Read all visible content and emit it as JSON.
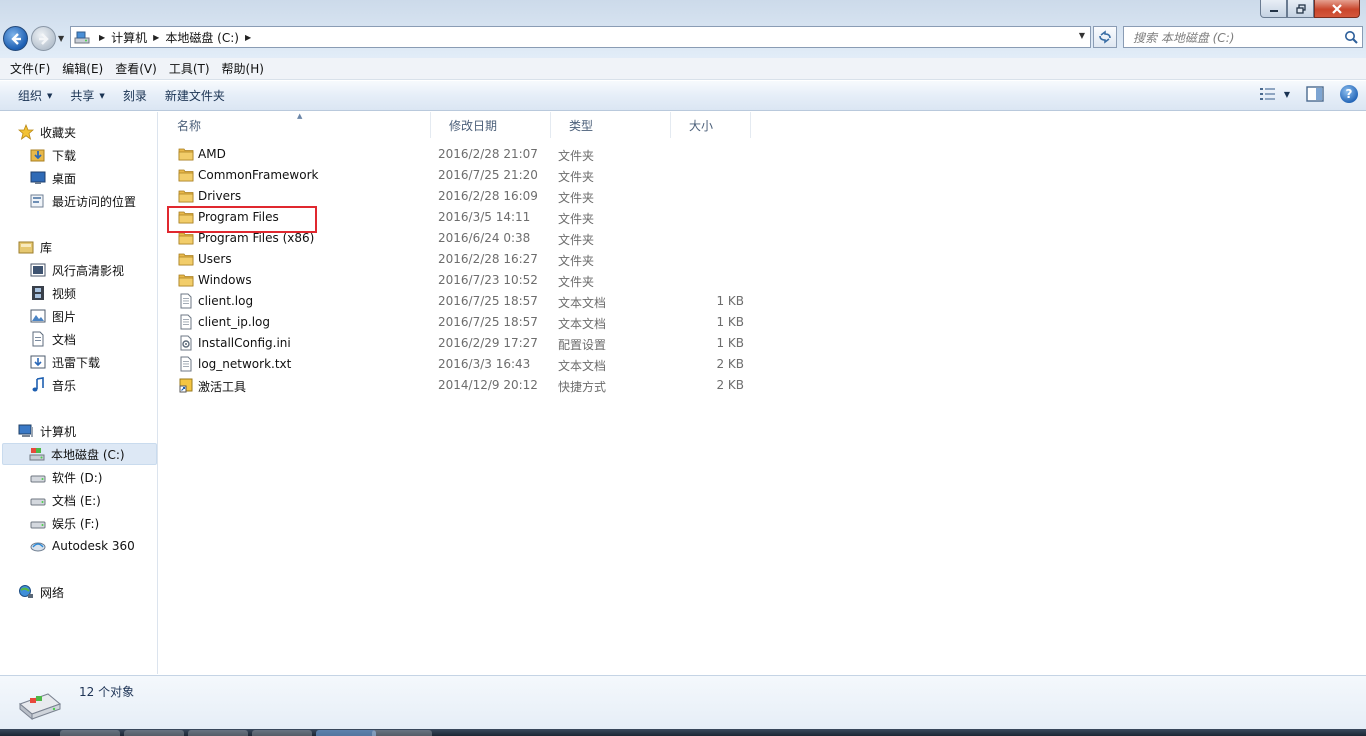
{
  "address": {
    "crumbs": [
      "计算机",
      "本地磁盘 (C:)"
    ]
  },
  "search": {
    "placeholder": "搜索 本地磁盘 (C:)"
  },
  "menubar": {
    "file": "文件(F)",
    "edit": "编辑(E)",
    "view": "查看(V)",
    "tools": "工具(T)",
    "help": "帮助(H)"
  },
  "toolbar": {
    "organize": "组织",
    "share": "共享",
    "burn": "刻录",
    "new_folder": "新建文件夹"
  },
  "navpane": {
    "favorites": "收藏夹",
    "downloads": "下载",
    "desktop": "桌面",
    "recent": "最近访问的位置",
    "libraries": "库",
    "lib_fengxing": "风行高清影视",
    "lib_video": "视频",
    "lib_pictures": "图片",
    "lib_docs": "文档",
    "lib_xunlei": "迅雷下载",
    "lib_music": "音乐",
    "computer": "计算机",
    "drive_c": "本地磁盘 (C:)",
    "drive_d": "软件 (D:)",
    "drive_e": "文档 (E:)",
    "drive_f": "娱乐 (F:)",
    "autodesk": "Autodesk 360",
    "network": "网络"
  },
  "columns": {
    "name": "名称",
    "date": "修改日期",
    "type": "类型",
    "size": "大小"
  },
  "files": [
    {
      "name": "AMD",
      "date": "2016/2/28 21:07",
      "type": "文件夹",
      "size": "",
      "icon": "folder-icon"
    },
    {
      "name": "CommonFramework",
      "date": "2016/7/25 21:20",
      "type": "文件夹",
      "size": "",
      "icon": "folder-icon"
    },
    {
      "name": "Drivers",
      "date": "2016/2/28 16:09",
      "type": "文件夹",
      "size": "",
      "icon": "folder-icon"
    },
    {
      "name": "Program Files",
      "date": "2016/3/5 14:11",
      "type": "文件夹",
      "size": "",
      "icon": "folder-icon"
    },
    {
      "name": "Program Files (x86)",
      "date": "2016/6/24 0:38",
      "type": "文件夹",
      "size": "",
      "icon": "folder-icon"
    },
    {
      "name": "Users",
      "date": "2016/2/28 16:27",
      "type": "文件夹",
      "size": "",
      "icon": "folder-icon"
    },
    {
      "name": "Windows",
      "date": "2016/7/23 10:52",
      "type": "文件夹",
      "size": "",
      "icon": "folder-icon"
    },
    {
      "name": "client.log",
      "date": "2016/7/25 18:57",
      "type": "文本文档",
      "size": "1 KB",
      "icon": "text-file-icon"
    },
    {
      "name": "client_ip.log",
      "date": "2016/7/25 18:57",
      "type": "文本文档",
      "size": "1 KB",
      "icon": "text-file-icon"
    },
    {
      "name": "InstallConfig.ini",
      "date": "2016/2/29 17:27",
      "type": "配置设置",
      "size": "1 KB",
      "icon": "config-file-icon"
    },
    {
      "name": "log_network.txt",
      "date": "2016/3/3 16:43",
      "type": "文本文档",
      "size": "2 KB",
      "icon": "text-file-icon"
    },
    {
      "name": "激活工具",
      "date": "2014/12/9 20:12",
      "type": "快捷方式",
      "size": "2 KB",
      "icon": "shortcut-icon"
    }
  ],
  "status": {
    "count": "12 个对象"
  },
  "colors": {
    "highlight": "#e0282f",
    "folder": "#e8b84a",
    "selection": "#dde8f5"
  }
}
